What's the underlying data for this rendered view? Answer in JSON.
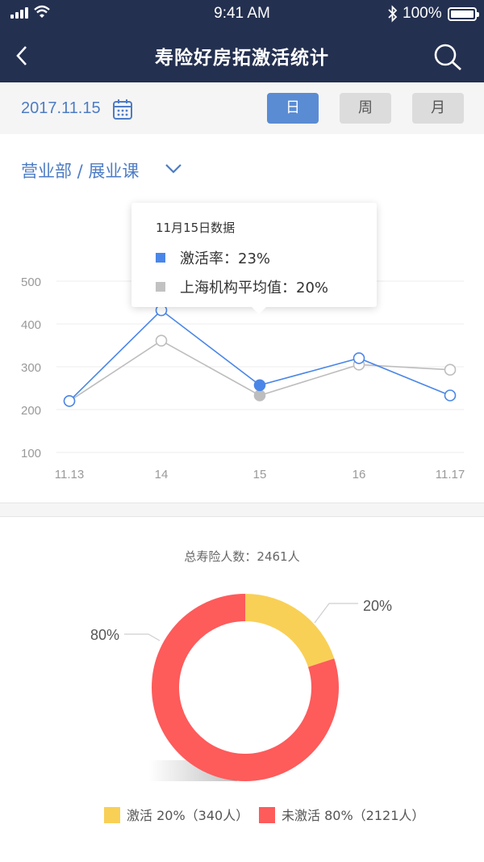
{
  "status": {
    "time": "9:41 AM",
    "battery": "100%"
  },
  "header": {
    "title": "寿险好房拓激活统计"
  },
  "filter": {
    "date": "2017.11.15",
    "periods": [
      "日",
      "周",
      "月"
    ],
    "active_period": "日"
  },
  "dept": {
    "label": "营业部 / 展业课"
  },
  "tooltip": {
    "title": "11月15日数据",
    "rows": [
      {
        "label": "激活率：23%",
        "color": "#4a86e8"
      },
      {
        "label": "上海机构平均值：20%",
        "color": "#c2c2c2"
      }
    ]
  },
  "chart_data": [
    {
      "type": "line",
      "x": [
        "11.13",
        "14",
        "15",
        "16",
        "11.17"
      ],
      "yticks": [
        100,
        200,
        300,
        400,
        500
      ],
      "ylim": [
        100,
        500
      ],
      "grid": true,
      "series": [
        {
          "values": [
            220,
            432,
            257,
            320,
            233
          ],
          "color": "#4a86e8"
        },
        {
          "values": [
            220,
            361,
            233,
            305,
            293
          ],
          "color": "#bdbdbd"
        }
      ],
      "highlight_index": 2
    },
    {
      "type": "pie",
      "title": "总寿险人数：2461人",
      "slices": [
        {
          "label": "激活 20%（340人）",
          "value": 20,
          "pct": "20%",
          "color": "#f9d056"
        },
        {
          "label": "未激活 80%（2121人）",
          "value": 80,
          "pct": "80%",
          "color": "#fe5b5b"
        }
      ]
    }
  ],
  "icons": {
    "back": "chevron-left-icon",
    "search": "search-icon",
    "calendar": "calendar-icon",
    "dropdown": "chevron-down-icon"
  }
}
